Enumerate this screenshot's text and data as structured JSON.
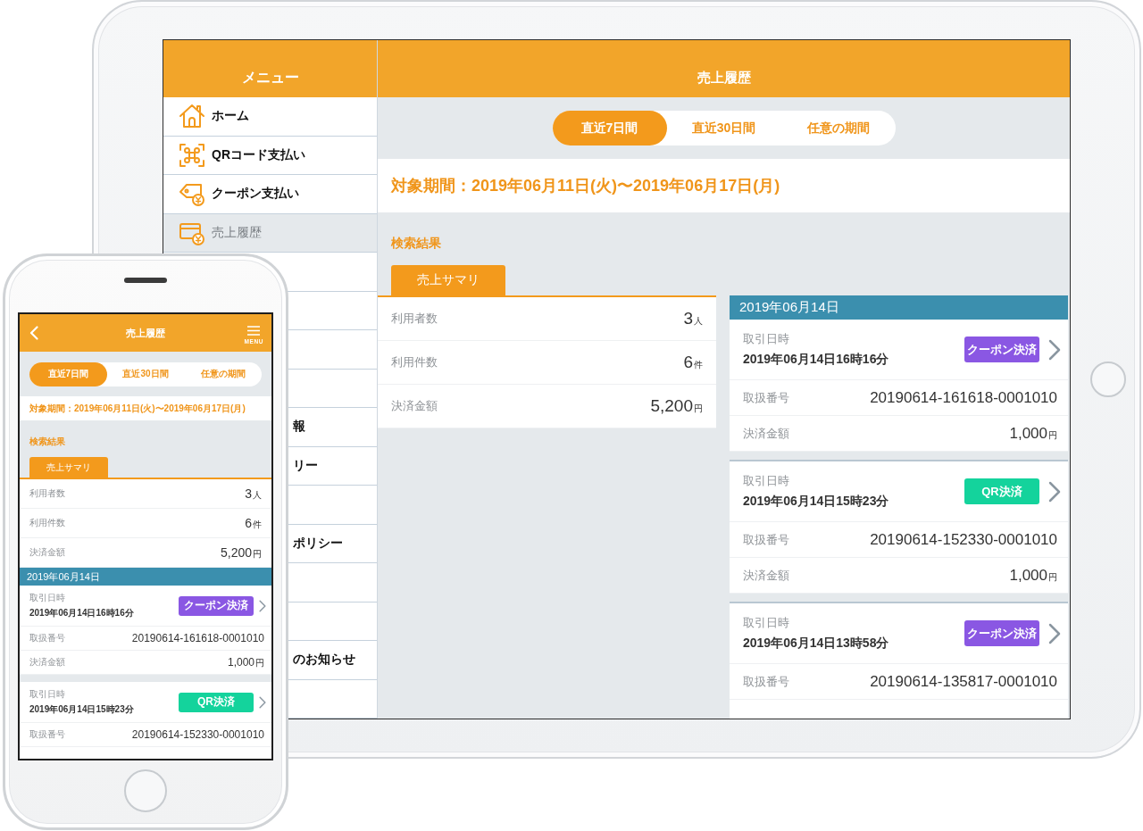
{
  "tablet": {
    "sidebar": {
      "title": "メニュー",
      "items": [
        {
          "kind": "full",
          "label": "ホーム",
          "selected": false
        },
        {
          "kind": "full",
          "label": "QRコード支払い",
          "selected": false
        },
        {
          "kind": "full",
          "label": "クーポン支払い",
          "selected": false
        },
        {
          "kind": "full",
          "label": "売上履歴",
          "selected": true
        },
        {
          "kind": "blank",
          "selected": false
        },
        {
          "kind": "blank",
          "selected": false
        },
        {
          "kind": "blank",
          "selected": false
        },
        {
          "kind": "blank",
          "selected": false
        },
        {
          "kind": "covered",
          "label": "報",
          "selected": false
        },
        {
          "kind": "covered",
          "label": "リー",
          "selected": false
        },
        {
          "kind": "blank",
          "selected": false
        },
        {
          "kind": "covered",
          "label": "ポリシー",
          "selected": false
        },
        {
          "kind": "blank",
          "selected": false
        },
        {
          "kind": "blank",
          "selected": false
        },
        {
          "kind": "covered",
          "label": "のお知らせ",
          "selected": false
        },
        {
          "kind": "blank",
          "selected": false
        }
      ]
    },
    "header": {
      "title": "売上履歴"
    },
    "period_tabs": [
      {
        "label": "直近7日間",
        "selected": true
      },
      {
        "label": "直近30日間",
        "selected": false
      },
      {
        "label": "任意の期間",
        "selected": false
      }
    ],
    "period": "対象期間：2019年06月11日(火)〜2019年06月17日(月)",
    "results_title": "検索結果",
    "summary_tab": {
      "label": "売上サマリ",
      "selected": true
    },
    "summary": [
      {
        "label": "利用者数",
        "value": "3",
        "unit": "人"
      },
      {
        "label": "利用件数",
        "value": "6",
        "unit": "件"
      },
      {
        "label": "決済金額",
        "value": "5,200",
        "unit": "円"
      }
    ],
    "date_header": "2019年06月14日",
    "transactions": [
      {
        "datetime_label": "取引日時",
        "datetime": "2019年06月14日16時16分",
        "badge": {
          "label": "クーポン決済",
          "color": "#8a57e3"
        },
        "details": [
          {
            "label": "取扱番号",
            "value": "20190614-161618-0001010"
          },
          {
            "label": "決済金額",
            "value": "1,000",
            "unit": "円"
          }
        ]
      },
      {
        "datetime_label": "取引日時",
        "datetime": "2019年06月14日15時23分",
        "badge": {
          "label": "QR決済",
          "color": "#14d39c"
        },
        "details": [
          {
            "label": "取扱番号",
            "value": "20190614-152330-0001010"
          },
          {
            "label": "決済金額",
            "value": "1,000",
            "unit": "円"
          }
        ]
      },
      {
        "datetime_label": "取引日時",
        "datetime": "2019年06月14日13時58分",
        "badge": {
          "label": "クーポン決済",
          "color": "#8a57e3"
        },
        "details": [
          {
            "label": "取扱番号",
            "value": "20190614-135817-0001010"
          }
        ]
      }
    ]
  },
  "phone": {
    "header": {
      "title": "売上履歴",
      "menu_label": "MENU"
    },
    "period_tabs": [
      {
        "label": "直近7日間",
        "selected": true
      },
      {
        "label": "直近30日間",
        "selected": false
      },
      {
        "label": "任意の期間",
        "selected": false
      }
    ],
    "period": "対象期間：2019年06月11日(火)〜2019年06月17日(月)",
    "results_title": "検索結果",
    "summary_tab": {
      "label": "売上サマリ",
      "selected": true
    },
    "summary": [
      {
        "label": "利用者数",
        "value": "3",
        "unit": "人"
      },
      {
        "label": "利用件数",
        "value": "6",
        "unit": "件"
      },
      {
        "label": "決済金額",
        "value": "5,200",
        "unit": "円"
      }
    ],
    "date_header": "2019年06月14日",
    "transactions": [
      {
        "datetime_label": "取引日時",
        "datetime": "2019年06月14日16時16分",
        "badge": {
          "label": "クーポン決済",
          "color": "#8a57e3"
        },
        "details": [
          {
            "label": "取扱番号",
            "value": "20190614-161618-0001010"
          },
          {
            "label": "決済金額",
            "value": "1,000",
            "unit": "円"
          }
        ]
      },
      {
        "datetime_label": "取引日時",
        "datetime": "2019年06月14日15時23分",
        "badge": {
          "label": "QR決済",
          "color": "#14d39c"
        },
        "details": [
          {
            "label": "取扱番号",
            "value": "20190614-152330-0001010"
          }
        ]
      }
    ]
  }
}
